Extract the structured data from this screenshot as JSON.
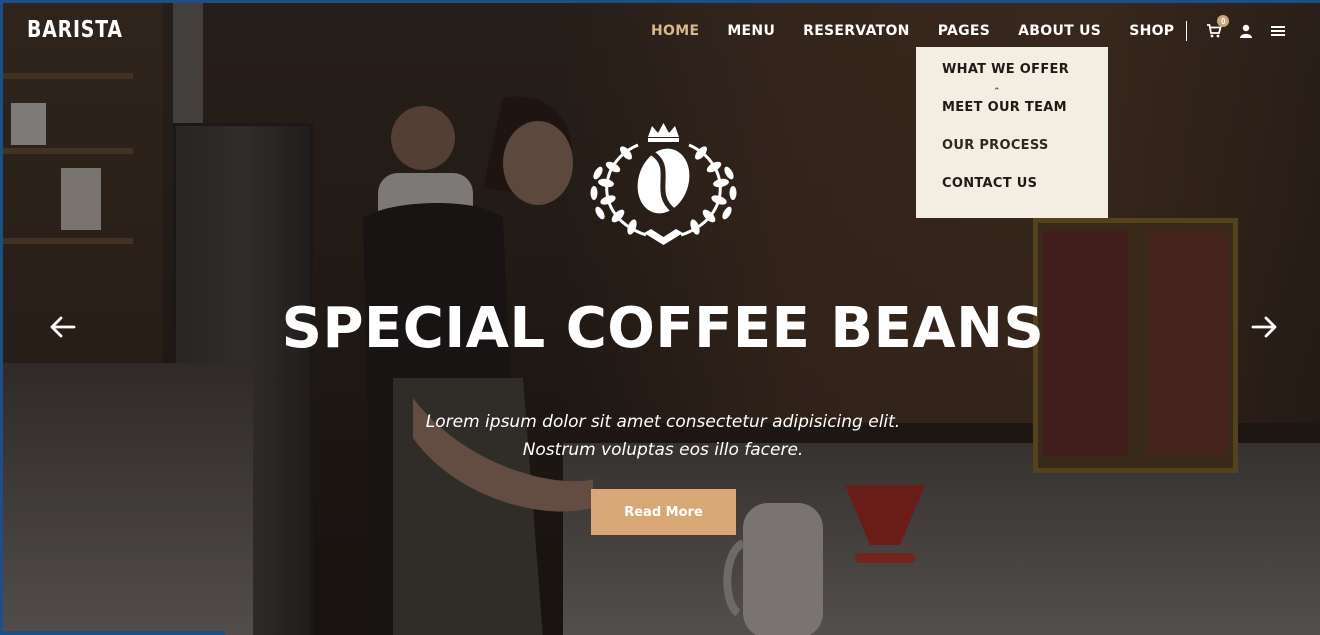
{
  "brand": {
    "logo_text": "BARISTA"
  },
  "nav": {
    "items": [
      {
        "label": "HOME",
        "active": true
      },
      {
        "label": "MENU",
        "active": false
      },
      {
        "label": "RESERVATON",
        "active": false
      },
      {
        "label": "PAGES",
        "active": false
      },
      {
        "label": "ABOUT US",
        "active": false
      },
      {
        "label": "SHOP",
        "active": false
      }
    ],
    "cart_count": "0",
    "icons": [
      "cart-icon",
      "user-icon",
      "menu-icon"
    ]
  },
  "dropdown": {
    "items": [
      {
        "label": "WHAT WE OFFER"
      },
      {
        "label": "MEET OUR TEAM"
      },
      {
        "label": "OUR PROCESS"
      },
      {
        "label": "CONTACT US"
      }
    ]
  },
  "hero": {
    "title": "SPECIAL COFFEE BEANS",
    "subtitle_line1": "Lorem ipsum dolor sit amet consectetur adipisicing elit.",
    "subtitle_line2": "Nostrum voluptas eos illo facere.",
    "button_label": "Read More",
    "emblem_icon": "coffee-bean-laurel-icon"
  },
  "slider": {
    "prev_icon": "arrow-left-icon",
    "next_icon": "arrow-right-icon"
  },
  "colors": {
    "accent": "#d9a877",
    "active_nav": "#d7b98c",
    "dropdown_bg": "#f4ede2",
    "text_light": "#ffffff"
  }
}
